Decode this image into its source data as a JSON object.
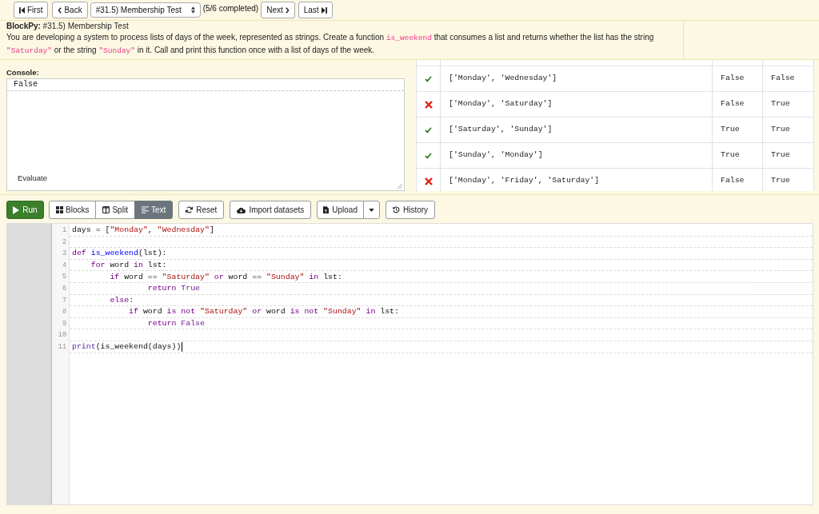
{
  "navigation": {
    "first": "First",
    "back": "Back",
    "assignment": "#31.5) Membership Test",
    "progress": "(5/6 completed)",
    "next": "Next",
    "last": "Last"
  },
  "instructions": {
    "heading": "**BlockPy:** #31.5) Membership Test",
    "description": [
      {
        "kind": "text",
        "text": "You are developing a system to process lists of days of the week, represented as strings. Create a function "
      },
      {
        "kind": "code",
        "text": "is_weekend"
      },
      {
        "kind": "text",
        "text": " that consumes a list and returns whether the list has the string "
      },
      {
        "kind": "code",
        "text": "\"Saturday\""
      },
      {
        "kind": "text",
        "text": " or the string "
      },
      {
        "kind": "code",
        "text": "\"Sunday\""
      },
      {
        "kind": "text",
        "text": " in it. Call and print this function once with a list of days of the week."
      }
    ]
  },
  "console": {
    "label": "Console:",
    "output": [
      "False"
    ],
    "evaluate": "Evaluate"
  },
  "tests": {
    "rows": [
      {
        "passed": true,
        "cells": [
          "['Monday', 'Wednesday']",
          "False",
          "False"
        ]
      },
      {
        "passed": false,
        "cells": [
          "['Monday', 'Saturday']",
          "False",
          "True"
        ]
      },
      {
        "passed": true,
        "cells": [
          "['Saturday', 'Sunday']",
          "True",
          "True"
        ]
      },
      {
        "passed": true,
        "cells": [
          "['Sunday', 'Monday']",
          "True",
          "True"
        ]
      },
      {
        "passed": false,
        "cells": [
          "['Monday', 'Friday', 'Saturday']",
          "False",
          "True"
        ]
      }
    ]
  },
  "toolbar": {
    "run": "Run",
    "editor_modes": [
      {
        "label": "Blocks",
        "selected": false
      },
      {
        "label": "Split",
        "selected": false
      },
      {
        "label": "Text",
        "selected": true
      }
    ],
    "reset": "Reset",
    "import": "Import datasets",
    "upload": "Upload",
    "history": "History"
  },
  "editor": {
    "lines": [
      {
        "number": "1",
        "cursor": false,
        "tokens": [
          {
            "kind": "plain",
            "text": "days = ["
          },
          {
            "kind": "string",
            "text": "\"Monday\""
          },
          {
            "kind": "plain",
            "text": ", "
          },
          {
            "kind": "string",
            "text": "\"Wednesday\""
          },
          {
            "kind": "plain",
            "text": "]"
          }
        ]
      },
      {
        "number": "2",
        "cursor": false
      },
      {
        "number": "3",
        "cursor": false,
        "tokens": [
          {
            "kind": "keyword",
            "text": "def"
          },
          {
            "kind": "def",
            "text": " is_weekend"
          },
          {
            "kind": "plain",
            "text": "(lst):"
          }
        ]
      },
      {
        "number": "4",
        "cursor": false,
        "tokens": [
          {
            "kind": "keyword",
            "text": "    for"
          },
          {
            "kind": "plain",
            "text": " word "
          },
          {
            "kind": "keyword",
            "text": "in"
          },
          {
            "kind": "plain",
            "text": " lst:"
          }
        ]
      },
      {
        "number": "5",
        "cursor": false,
        "tokens": [
          {
            "kind": "keyword",
            "text": "        if"
          },
          {
            "kind": "plain",
            "text": " word == "
          },
          {
            "kind": "string",
            "text": "\"Saturday\""
          },
          {
            "kind": "keyword",
            "text": " or"
          },
          {
            "kind": "plain",
            "text": " word == "
          },
          {
            "kind": "string",
            "text": "\"Sunday\""
          },
          {
            "kind": "keyword",
            "text": " in"
          },
          {
            "kind": "plain",
            "text": " lst:"
          }
        ]
      },
      {
        "number": "6",
        "cursor": false,
        "tokens": [
          {
            "kind": "keyword",
            "text": "                return"
          },
          {
            "kind": "atom",
            "text": " True"
          }
        ]
      },
      {
        "number": "7",
        "cursor": false,
        "tokens": [
          {
            "kind": "keyword",
            "text": "        else"
          },
          {
            "kind": "plain",
            "text": ":"
          }
        ]
      },
      {
        "number": "8",
        "cursor": false,
        "tokens": [
          {
            "kind": "keyword",
            "text": "            if"
          },
          {
            "kind": "plain",
            "text": " word "
          },
          {
            "kind": "keyword",
            "text": "is not"
          },
          {
            "kind": "string",
            "text": " \"Saturday\""
          },
          {
            "kind": "keyword",
            "text": " or"
          },
          {
            "kind": "plain",
            "text": " word "
          },
          {
            "kind": "keyword",
            "text": "is not"
          },
          {
            "kind": "string",
            "text": " \"Sunday\""
          },
          {
            "kind": "keyword",
            "text": " in"
          },
          {
            "kind": "plain",
            "text": " lst:"
          }
        ]
      },
      {
        "number": "9",
        "cursor": false,
        "tokens": [
          {
            "kind": "keyword",
            "text": "                return"
          },
          {
            "kind": "atom",
            "text": " False"
          }
        ]
      },
      {
        "number": "10",
        "cursor": false
      },
      {
        "number": "11",
        "cursor": true,
        "tokens": [
          {
            "kind": "builtin",
            "text": "print"
          },
          {
            "kind": "plain",
            "text": "(is_weekend(days))"
          }
        ]
      }
    ]
  }
}
